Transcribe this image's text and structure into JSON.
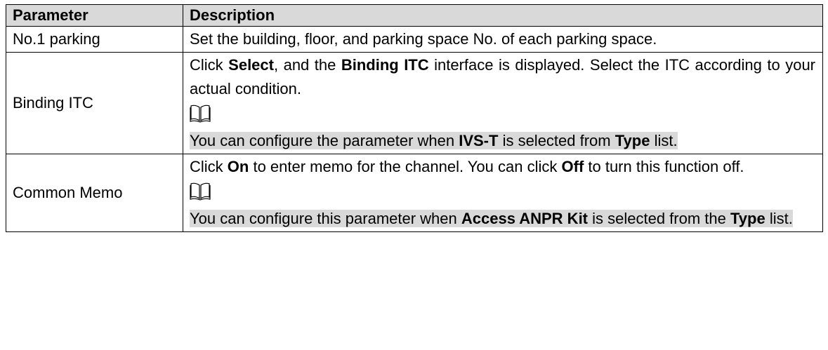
{
  "table": {
    "headers": {
      "parameter": "Parameter",
      "description": "Description"
    },
    "rows": [
      {
        "parameter": "No.1 parking",
        "description": {
          "text": "Set the building, floor, and parking space No. of each parking space."
        }
      },
      {
        "parameter": "Binding ITC",
        "description": {
          "t1": "Click ",
          "b1": "Select",
          "t2": ", and the ",
          "b2": "Binding ITC",
          "t3": " interface is displayed. Select the ITC according to your actual condition.",
          "note": {
            "icon": "book-icon",
            "t1": "You can configure the parameter when ",
            "b1": "IVS-T",
            "t2": " is selected from ",
            "b2": "Type",
            "t3": " list."
          }
        }
      },
      {
        "parameter": "Common Memo",
        "description": {
          "t1": "Click ",
          "b1": "On",
          "t2": " to enter memo for the channel. You can click ",
          "b2": "Off",
          "t3": " to turn this function off.",
          "note": {
            "icon": "book-icon",
            "t1": "You can configure this parameter when ",
            "b1": "Access ANPR Kit",
            "t2": " is selected from the ",
            "b2": "Type",
            "t3": " list."
          }
        }
      }
    ]
  },
  "colors": {
    "header_background": "#d9d9d9",
    "note_highlight": "#d9d9d9",
    "border": "#000000"
  }
}
